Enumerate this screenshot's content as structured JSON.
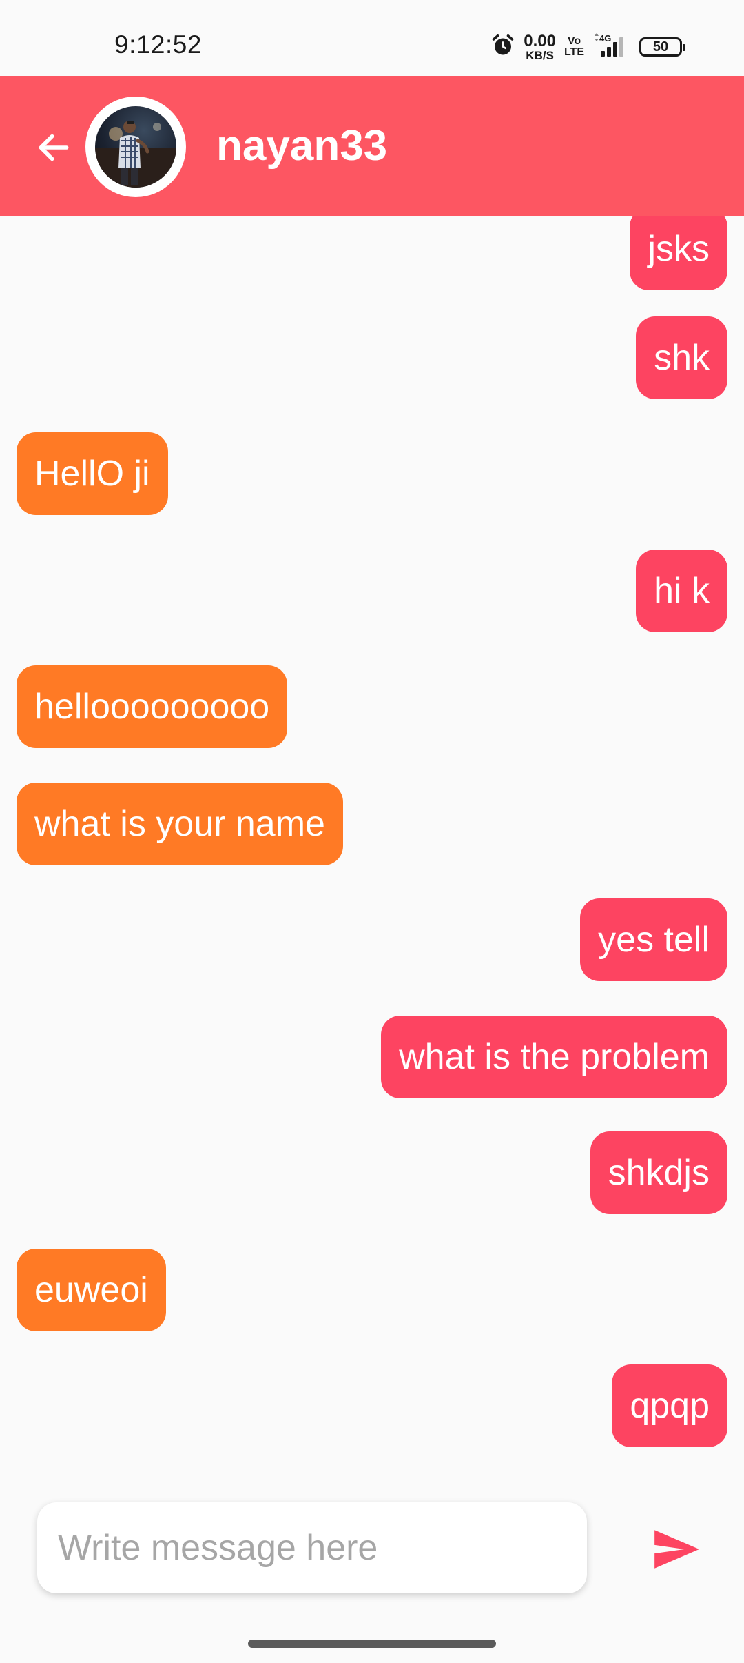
{
  "status_bar": {
    "time": "9:12:52",
    "net_speed_value": "0.00",
    "net_speed_unit": "KB/S",
    "volte_top": "Vo",
    "volte_bottom": "LTE",
    "network_type": "4G",
    "battery_level": "50",
    "icons": [
      "alarm-icon",
      "signal-icon",
      "battery-icon"
    ]
  },
  "header": {
    "back_icon": "arrow-left-icon",
    "contact_name": "nayan33",
    "avatar": "contact-avatar"
  },
  "colors": {
    "header_bg": "#fd5662",
    "sent_bubble": "#fd4461",
    "received_bubble": "#ff7a25",
    "background": "#fafafa"
  },
  "messages": [
    {
      "text": "jsks",
      "direction": "sent"
    },
    {
      "text": "shk",
      "direction": "sent"
    },
    {
      "text": "HellO ji",
      "direction": "received"
    },
    {
      "text": "hi k",
      "direction": "sent"
    },
    {
      "text": "hellooooooooo",
      "direction": "received"
    },
    {
      "text": "what is your name",
      "direction": "received"
    },
    {
      "text": "yes tell",
      "direction": "sent"
    },
    {
      "text": "what is the problem",
      "direction": "sent"
    },
    {
      "text": "shkdjs",
      "direction": "sent"
    },
    {
      "text": "euweoi",
      "direction": "received"
    },
    {
      "text": "qpqp",
      "direction": "sent"
    }
  ],
  "composer": {
    "placeholder": "Write message here",
    "value": "",
    "send_icon": "send-icon"
  }
}
